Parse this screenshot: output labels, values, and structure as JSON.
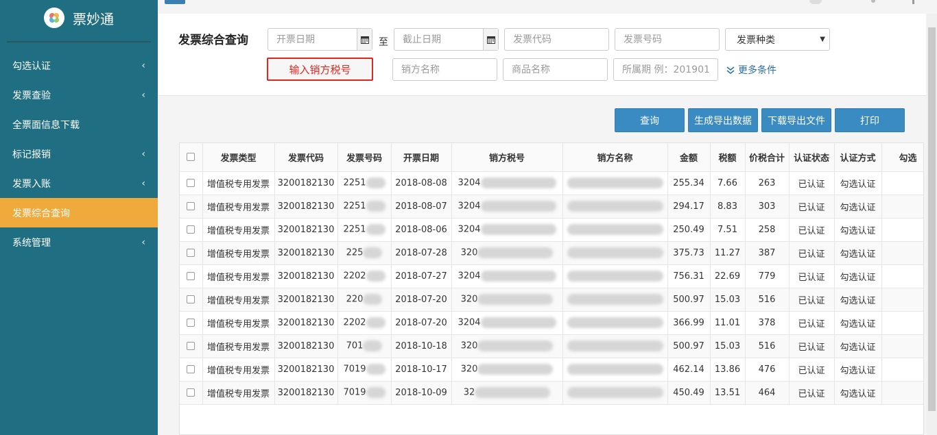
{
  "sidebar": {
    "brand": "票妙通",
    "items": [
      {
        "label": "勾选认证",
        "has_arrow": true,
        "active": false
      },
      {
        "label": "发票查验",
        "has_arrow": true,
        "active": false
      },
      {
        "label": "全票面信息下载",
        "has_arrow": false,
        "active": false
      },
      {
        "label": "标记报销",
        "has_arrow": true,
        "active": false
      },
      {
        "label": "发票入账",
        "has_arrow": true,
        "active": false
      },
      {
        "label": "发票综合查询",
        "has_arrow": false,
        "active": true
      },
      {
        "label": "系统管理",
        "has_arrow": true,
        "active": false
      }
    ],
    "arrow": "‹"
  },
  "filter": {
    "title": "发票综合查询",
    "start_date_placeholder": "开票日期",
    "to_label": "至",
    "end_date_placeholder": "截止日期",
    "invoice_code_placeholder": "发票代码",
    "invoice_number_placeholder": "发票号码",
    "invoice_type_select": "发票种类",
    "seller_tax_placeholder": "输入销方税号",
    "seller_name_placeholder": "销方名称",
    "goods_name_placeholder": "商品名称",
    "period_placeholder": "所属期 例：201901",
    "more_conditions": "更多条件"
  },
  "actions": {
    "query": "查询",
    "generate_export": "生成导出数据",
    "download_export": "下载导出文件",
    "print": "打印"
  },
  "table": {
    "headers": [
      "发票类型",
      "发票代码",
      "发票号码",
      "开票日期",
      "销方税号",
      "销方名称",
      "金额",
      "税额",
      "价税合计",
      "认证状态",
      "认证方式",
      "勾选"
    ],
    "rows": [
      {
        "type": "增值税专用发票",
        "code": "3200182130",
        "number_prefix": "2251",
        "date": "2018-08-08",
        "tax_prefix": "3204",
        "amount": "255.34",
        "tax": "7.66",
        "total": "263",
        "status": "已认证",
        "method": "勾选认证"
      },
      {
        "type": "增值税专用发票",
        "code": "3200182130",
        "number_prefix": "2251",
        "date": "2018-08-07",
        "tax_prefix": "3204",
        "amount": "294.17",
        "tax": "8.83",
        "total": "303",
        "status": "已认证",
        "method": "勾选认证"
      },
      {
        "type": "增值税专用发票",
        "code": "3200182130",
        "number_prefix": "2251",
        "date": "2018-08-06",
        "tax_prefix": "3204",
        "amount": "250.49",
        "tax": "7.51",
        "total": "258",
        "status": "已认证",
        "method": "勾选认证"
      },
      {
        "type": "增值税专用发票",
        "code": "3200182130",
        "number_prefix": "225",
        "date": "2018-07-28",
        "tax_prefix": "320",
        "amount": "375.73",
        "tax": "11.27",
        "total": "387",
        "status": "已认证",
        "method": "勾选认证"
      },
      {
        "type": "增值税专用发票",
        "code": "3200182130",
        "number_prefix": "2202",
        "date": "2018-07-27",
        "tax_prefix": "3204",
        "amount": "756.31",
        "tax": "22.69",
        "total": "779",
        "status": "已认证",
        "method": "勾选认证"
      },
      {
        "type": "增值税专用发票",
        "code": "3200182130",
        "number_prefix": "220",
        "date": "2018-07-20",
        "tax_prefix": "320",
        "amount": "500.97",
        "tax": "15.03",
        "total": "516",
        "status": "已认证",
        "method": "勾选认证"
      },
      {
        "type": "增值税专用发票",
        "code": "3200182130",
        "number_prefix": "2202",
        "date": "2018-07-20",
        "tax_prefix": "3204",
        "amount": "366.99",
        "tax": "11.01",
        "total": "378",
        "status": "已认证",
        "method": "勾选认证"
      },
      {
        "type": "增值税专用发票",
        "code": "3200182130",
        "number_prefix": "701",
        "date": "2018-10-18",
        "tax_prefix": "320",
        "amount": "500.97",
        "tax": "15.03",
        "total": "516",
        "status": "已认证",
        "method": "勾选认证"
      },
      {
        "type": "增值税专用发票",
        "code": "3200182130",
        "number_prefix": "7019",
        "date": "2018-10-17",
        "tax_prefix": "320",
        "amount": "462.14",
        "tax": "13.86",
        "total": "476",
        "status": "已认证",
        "method": "勾选认证"
      },
      {
        "type": "增值税专用发票",
        "code": "3200182130",
        "number_prefix": "7019",
        "date": "2018-10-09",
        "tax_prefix": "32",
        "amount": "450.49",
        "tax": "13.51",
        "total": "464",
        "status": "已认证",
        "method": "勾选认证"
      }
    ]
  }
}
